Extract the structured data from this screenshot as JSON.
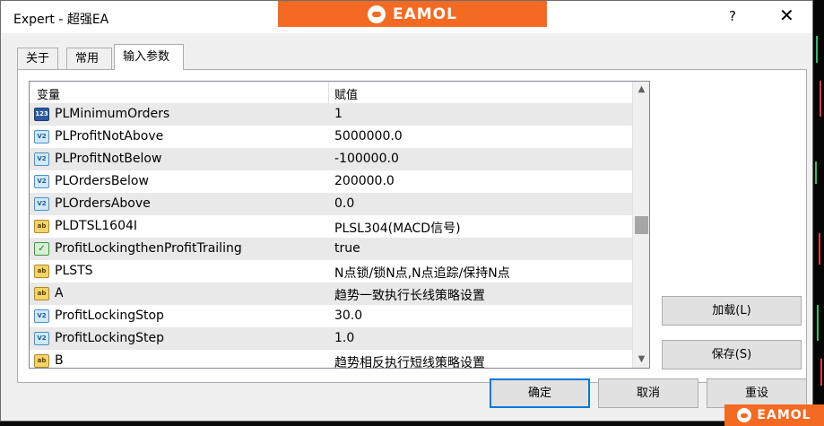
{
  "window": {
    "title": "Expert - 超强EA",
    "help_label": "?",
    "close_label": "✕"
  },
  "brand": {
    "name": "EAMOL",
    "color": "#f46a22"
  },
  "tabs": [
    {
      "label": "关于",
      "active": false
    },
    {
      "label": "常用",
      "active": false
    },
    {
      "label": "输入参数",
      "active": true
    }
  ],
  "grid": {
    "header": {
      "variable": "变量",
      "value": "赋值"
    },
    "rows": [
      {
        "type": "int",
        "icon_text": "123",
        "name": "PLMinimumOrders",
        "value": "1"
      },
      {
        "type": "double",
        "icon_text": "V2",
        "name": "PLProfitNotAbove",
        "value": "5000000.0"
      },
      {
        "type": "double",
        "icon_text": "V2",
        "name": "PLProfitNotBelow",
        "value": "-100000.0"
      },
      {
        "type": "double",
        "icon_text": "V2",
        "name": "PLOrdersBelow",
        "value": "200000.0"
      },
      {
        "type": "double",
        "icon_text": "V2",
        "name": "PLOrdersAbove",
        "value": "0.0"
      },
      {
        "type": "string",
        "icon_text": "ab",
        "name": "PLDTSL1604I",
        "value": "PLSL304(MACD信号)"
      },
      {
        "type": "bool",
        "icon_text": "✓",
        "name": "ProfitLockingthenProfitTrailing",
        "value": "true"
      },
      {
        "type": "string",
        "icon_text": "ab",
        "name": "PLSTS",
        "value": "N点锁/锁N点,N点追踪/保持N点"
      },
      {
        "type": "string",
        "icon_text": "ab",
        "name": "A",
        "value": "趋势一致执行长线策略设置"
      },
      {
        "type": "double",
        "icon_text": "V2",
        "name": "ProfitLockingStop",
        "value": "30.0"
      },
      {
        "type": "double",
        "icon_text": "V2",
        "name": "ProfitLockingStep",
        "value": "1.0"
      },
      {
        "type": "string",
        "icon_text": "ab",
        "name": "B",
        "value": "趋势相反执行短线策略设置"
      }
    ]
  },
  "buttons": {
    "load": "加载(L)",
    "save": "保存(S)",
    "ok": "确定",
    "cancel": "取消",
    "reset": "重设"
  }
}
